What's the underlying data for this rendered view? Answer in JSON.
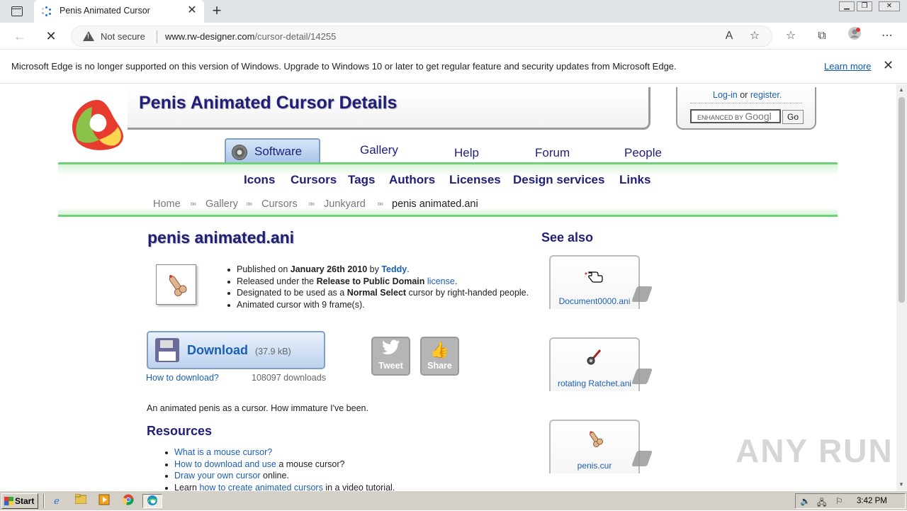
{
  "browser": {
    "tab_title": "Penis Animated Cursor",
    "new_tab_symbol": "+",
    "security_label": "Not secure",
    "url_host": "www.rw-designer.com",
    "url_path": "/cursor-detail/14255"
  },
  "infobar": {
    "message": "Microsoft Edge is no longer supported on this version of Windows. Upgrade to Windows 10 or later to get regular feature and security updates from Microsoft Edge.",
    "learn_more": "Learn more"
  },
  "header": {
    "title": "Penis Animated Cursor Details",
    "login": "Log-in",
    "or": "or",
    "register": "register.",
    "search_placeholder": "ENHANCED BY",
    "search_brand": "Googl",
    "go": "Go"
  },
  "main_tabs": [
    "Software",
    "Gallery",
    "Help",
    "Forum",
    "People"
  ],
  "sub_nav": [
    "Icons",
    "Cursors",
    "Tags",
    "Authors",
    "Licenses",
    "Design services",
    "Links"
  ],
  "breadcrumb": [
    "Home",
    "Gallery",
    "Cursors",
    "Junkyard",
    "penis animated.ani"
  ],
  "cursor": {
    "file_name": "penis animated.ani",
    "published_prefix": "Published on",
    "published_date": "January 26th 2010",
    "by": "by",
    "author": "Teddy",
    "released_prefix": "Released under the",
    "release_type": "Release to Public Domain",
    "license_link": "license",
    "designated_prefix": "Designated to be used as a",
    "cursor_role": "Normal Select",
    "designated_suffix": "cursor by right-handed people.",
    "frames_text": "Animated cursor with 9 frame(s).",
    "download_label": "Download",
    "download_size": "(37.9 kB)",
    "how_to_download": "How to download?",
    "download_count": "108097 downloads",
    "description": "An animated penis as a cursor. How immature I've been."
  },
  "social": {
    "tweet": "Tweet",
    "share": "Share"
  },
  "resources": {
    "heading": "Resources",
    "items": [
      {
        "link": "What is a mouse cursor?",
        "rest": ""
      },
      {
        "link": "How to download and use",
        "rest": " a mouse cursor?"
      },
      {
        "link": "Draw your own cursor",
        "rest": " online."
      },
      {
        "prefix": "Learn ",
        "link": "how to create animated cursors",
        "rest": " in a video tutorial."
      }
    ]
  },
  "see_also": {
    "heading": "See also",
    "items": [
      "Document0000.ani",
      "rotating Ratchet.ani",
      "penis.cur"
    ]
  },
  "watermark": "ANY RUN",
  "taskbar": {
    "start": "Start",
    "clock": "3:42 PM"
  },
  "colors": {
    "accent_navy": "#1f1f7a",
    "link_blue": "#1a5fb4",
    "nav_green": "#6fd07a"
  }
}
